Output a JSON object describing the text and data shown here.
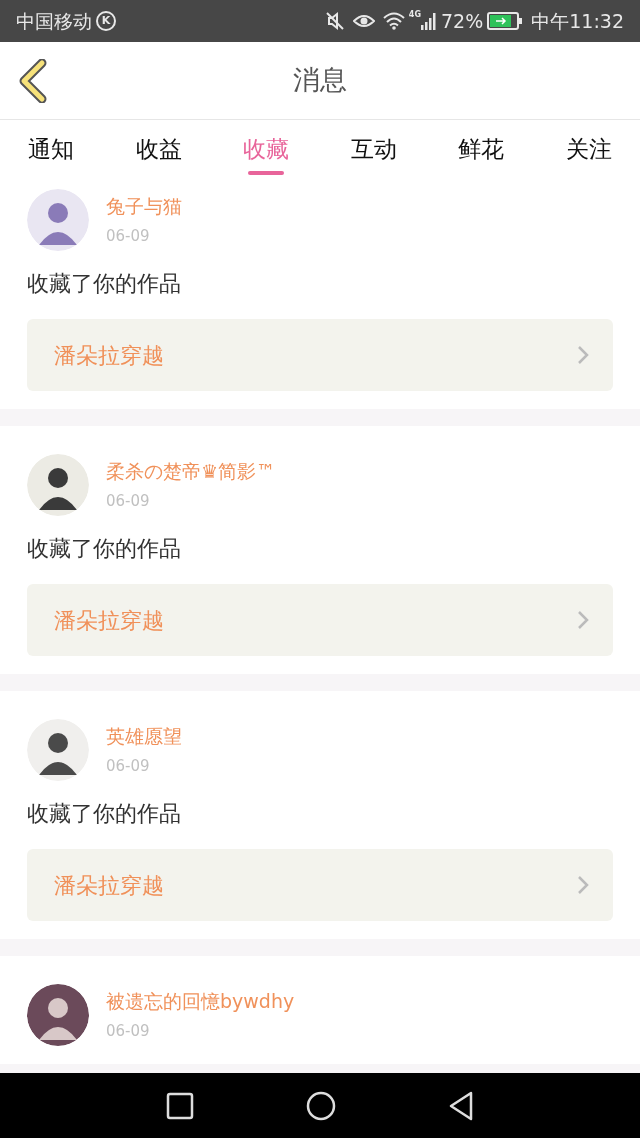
{
  "status_bar": {
    "carrier": "中国移动",
    "carrier_badge": "K",
    "network": "4G",
    "battery": "72%",
    "time": "中午11:32"
  },
  "header": {
    "title": "消息"
  },
  "tabs": [
    {
      "label": "通知",
      "selected": false
    },
    {
      "label": "收益",
      "selected": false
    },
    {
      "label": "收藏",
      "selected": true
    },
    {
      "label": "互动",
      "selected": false
    },
    {
      "label": "鲜花",
      "selected": false
    },
    {
      "label": "关注",
      "selected": false
    }
  ],
  "messages": [
    {
      "user": "兔子与猫",
      "date": "06-09",
      "text": "收藏了你的作品",
      "work": "潘朵拉穿越"
    },
    {
      "user": "柔杀の楚帝♛简影™",
      "date": "06-09",
      "text": "收藏了你的作品",
      "work": "潘朵拉穿越"
    },
    {
      "user": "英雄愿望",
      "date": "06-09",
      "text": "收藏了你的作品",
      "work": "潘朵拉穿越"
    },
    {
      "user": "被遗忘的回憶bywdhy",
      "date": "06-09"
    }
  ]
}
